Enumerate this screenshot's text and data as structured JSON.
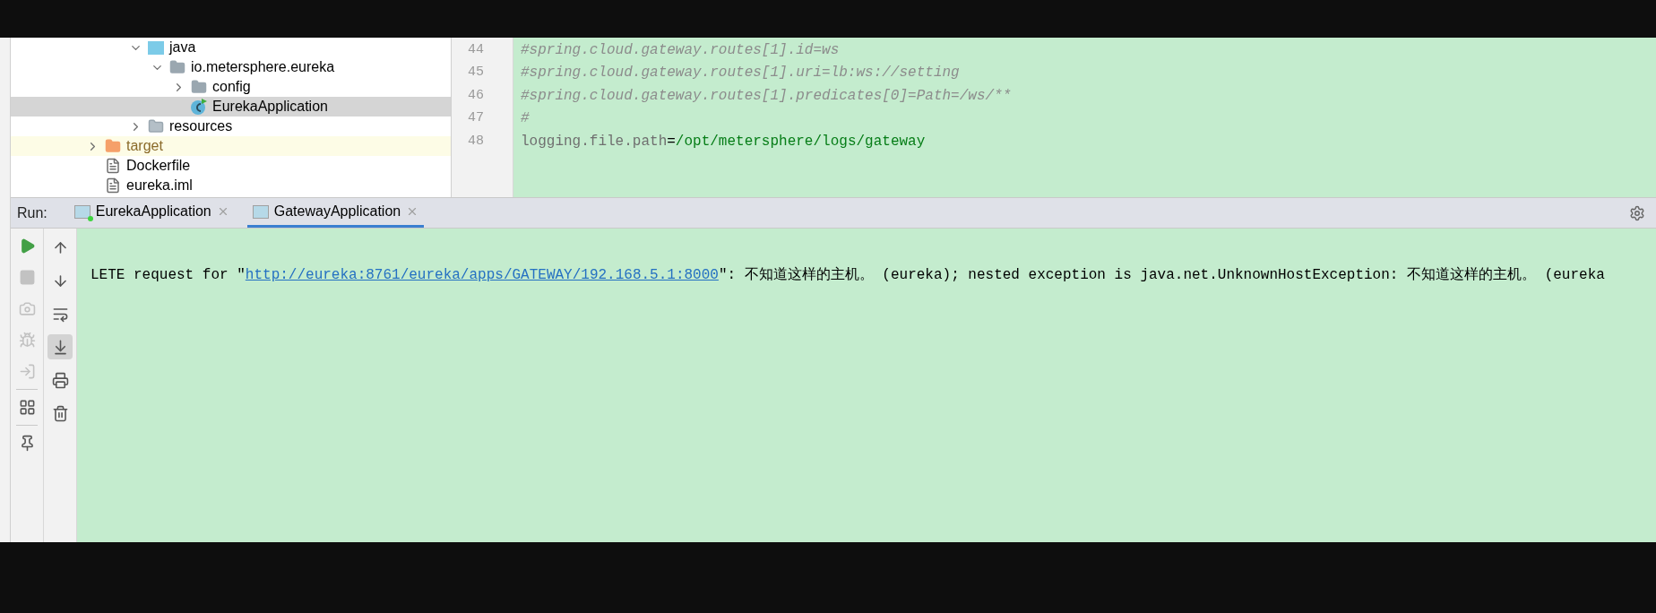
{
  "project_tree": {
    "source_items": [
      {
        "label": "java",
        "kind": "source-folder",
        "expanded": true,
        "selected": false,
        "children": [
          {
            "label": "io.metersphere.eureka",
            "kind": "package",
            "expanded": true,
            "selected": false,
            "children": [
              {
                "label": "config",
                "kind": "package",
                "expanded": false,
                "selected": false
              },
              {
                "label": "EurekaApplication",
                "kind": "class",
                "selected": true
              }
            ]
          }
        ]
      },
      {
        "label": "resources",
        "kind": "resources-folder",
        "expanded": false,
        "selected": false
      }
    ],
    "module_items": [
      {
        "label": "target",
        "kind": "excluded-folder",
        "expanded": false,
        "selected": false
      },
      {
        "label": "Dockerfile",
        "kind": "file",
        "selected": false
      },
      {
        "label": "eureka.iml",
        "kind": "file",
        "selected": false
      }
    ]
  },
  "editor": {
    "lines": [
      {
        "number": "44",
        "kind": "comment",
        "text": "#spring.cloud.gateway.routes[1].id=ws"
      },
      {
        "number": "45",
        "kind": "comment",
        "text": "#spring.cloud.gateway.routes[1].uri=lb:ws://setting"
      },
      {
        "number": "46",
        "kind": "comment",
        "text": "#spring.cloud.gateway.routes[1].predicates[0]=Path=/ws/**"
      },
      {
        "number": "47",
        "kind": "comment",
        "text": "#"
      },
      {
        "number": "48",
        "kind": "property",
        "key": "logging.file.path",
        "separator": "=",
        "value": "/opt/metersphere/logs/gateway"
      }
    ]
  },
  "run_panel": {
    "label": "Run:",
    "tabs": [
      {
        "label": "EurekaApplication",
        "selected": false,
        "running": true
      },
      {
        "label": "GatewayApplication",
        "selected": true,
        "running": false
      }
    ],
    "left_toolbar": [
      {
        "kind": "rerun",
        "disabled": false
      },
      {
        "kind": "stop",
        "disabled": true
      },
      {
        "kind": "dump",
        "disabled": true
      },
      {
        "kind": "debug",
        "disabled": true
      },
      {
        "kind": "exit",
        "disabled": true
      },
      {
        "kind": "layout",
        "disabled": false
      },
      {
        "kind": "pin",
        "disabled": false
      }
    ],
    "right_toolbar": [
      {
        "kind": "up",
        "toggled": false
      },
      {
        "kind": "down",
        "toggled": false
      },
      {
        "kind": "wrap",
        "toggled": false
      },
      {
        "kind": "scroll-end",
        "toggled": true
      },
      {
        "kind": "print",
        "toggled": false
      },
      {
        "kind": "clear",
        "toggled": false
      }
    ],
    "console": {
      "prefix": "LETE request for \"",
      "link": "http://eureka:8761/eureka/apps/GATEWAY/192.168.5.1:8000",
      "suffix": "\": 不知道这样的主机。 (eureka); nested exception is java.net.UnknownHostException: 不知道这样的主机。 (eureka"
    }
  }
}
